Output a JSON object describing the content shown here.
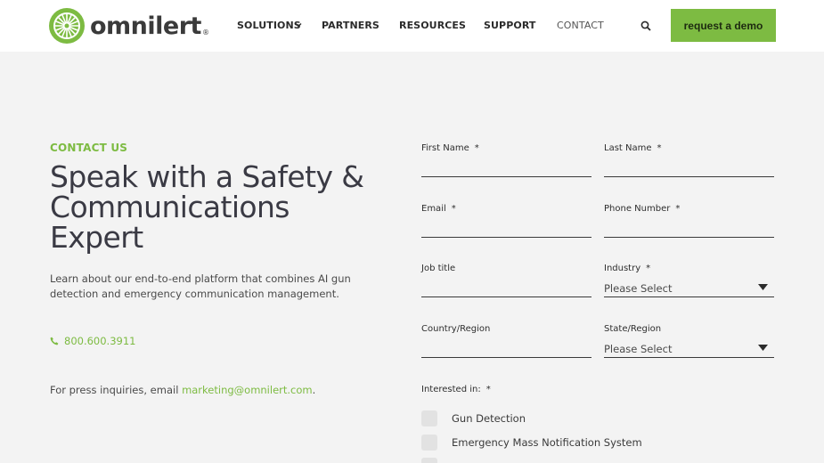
{
  "header": {
    "logo_text": "omnilert",
    "logo_reg": "®",
    "nav": [
      {
        "label": "SOLUTIONS"
      },
      {
        "label": "PARTNERS"
      },
      {
        "label": "RESOURCES"
      },
      {
        "label": "SUPPORT"
      },
      {
        "label": "CONTACT"
      }
    ],
    "demo_button": "request a demo",
    "icons": {
      "search": "search-icon",
      "dropdown": "chevron-down-icon"
    }
  },
  "hero": {
    "eyebrow": "CONTACT US",
    "headline": "Speak with a Safety & Communications Expert",
    "lead": "Learn about our end-to-end platform that combines AI gun detection and emergency communication management.",
    "phone": "800.600.3911",
    "press_prefix": "For press inquiries, email ",
    "press_email": "marketing@omnilert.com",
    "press_suffix": "."
  },
  "form": {
    "required_mark": "*",
    "first_name": {
      "label": "First Name",
      "value": ""
    },
    "last_name": {
      "label": "Last Name",
      "value": ""
    },
    "email": {
      "label": "Email",
      "value": ""
    },
    "phone": {
      "label": "Phone Number",
      "value": ""
    },
    "job_title": {
      "label": "Job title",
      "value": ""
    },
    "industry": {
      "label": "Industry",
      "value": "Please Select"
    },
    "country": {
      "label": "Country/Region",
      "value": ""
    },
    "state": {
      "label": "State/Region",
      "value": "Please Select"
    },
    "interested_label": "Interested in:",
    "interests": [
      {
        "label": "Gun Detection",
        "checked": false
      },
      {
        "label": "Emergency Mass Notification System",
        "checked": false
      }
    ]
  },
  "colors": {
    "brand_green": "#7dbb42",
    "text_dark": "#3a3a44",
    "background": "#f3f3f3"
  }
}
